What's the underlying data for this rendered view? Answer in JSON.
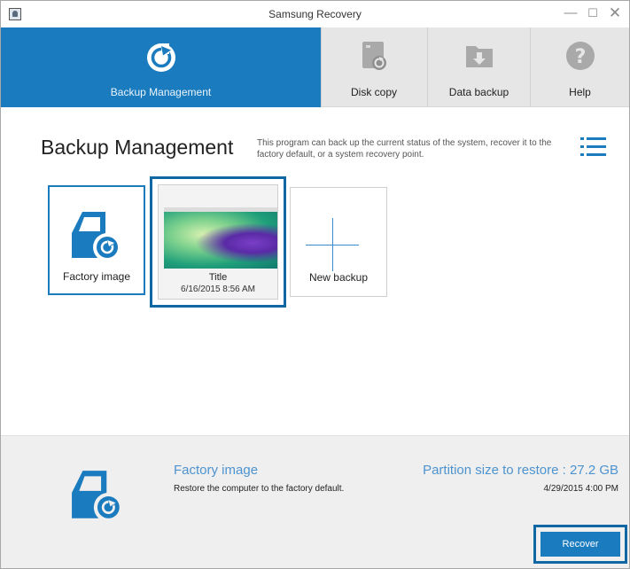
{
  "window": {
    "title": "Samsung Recovery"
  },
  "nav": {
    "items": [
      {
        "label": "Backup Management",
        "icon": "restore-arrow-icon",
        "active": true
      },
      {
        "label": "Disk copy",
        "icon": "disk-copy-icon"
      },
      {
        "label": "Data backup",
        "icon": "data-backup-icon"
      },
      {
        "label": "Help",
        "icon": "help-icon"
      }
    ]
  },
  "main": {
    "title": "Backup Management",
    "description": "This program can back up the current status of the system, recover it to the factory default, or a system recovery point.",
    "tiles": [
      {
        "label": "Factory image",
        "icon": "factory-image-icon"
      },
      {
        "label": "Title",
        "date": "6/16/2015 8:56 AM",
        "icon": "backup-thumbnail"
      },
      {
        "label": "New backup",
        "icon": "plus-icon"
      }
    ]
  },
  "details": {
    "name": "Factory image",
    "description": "Restore the computer to the factory default.",
    "partition_size": "Partition size to restore : 27.2 GB",
    "date": "4/29/2015 4:00 PM",
    "recover_label": "Recover"
  },
  "colors": {
    "accent": "#1b7bbf",
    "highlight_border": "#0f67a3",
    "link_text": "#4d93cf"
  }
}
